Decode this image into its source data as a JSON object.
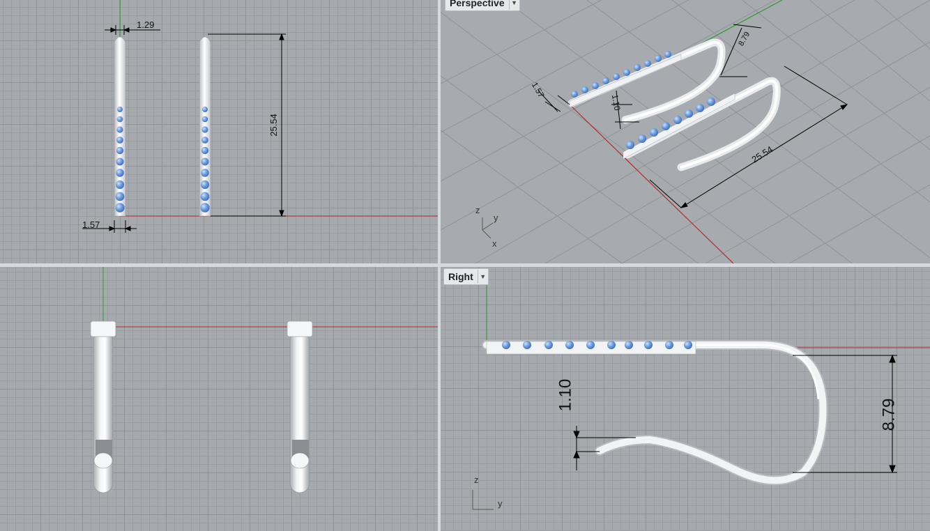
{
  "viewports": {
    "top": {
      "dimensions": {
        "wire_thickness": "1.29",
        "bar_width": "1.57",
        "length": "25.54"
      }
    },
    "perspective": {
      "title": "Perspective",
      "dimensions": {
        "width": "1.57",
        "stone_height": "1.10",
        "length": "25.54",
        "hook": "8.79"
      },
      "axes": {
        "z": "z",
        "y": "y",
        "x": "x"
      }
    },
    "front": {},
    "right": {
      "title": "Right",
      "dimensions": {
        "stone_height": "1.10",
        "hook_height": "8.79"
      },
      "axes": {
        "z": "z",
        "y": "y"
      }
    }
  },
  "colors": {
    "grid_bg": "#a6a9ad",
    "x_axis": "#b22a2a",
    "y_axis": "#2f9a2f",
    "metal": "#eef0f2",
    "stone": "#6f9fe0"
  },
  "icons": {
    "dropdown": "chevron-down-icon"
  }
}
